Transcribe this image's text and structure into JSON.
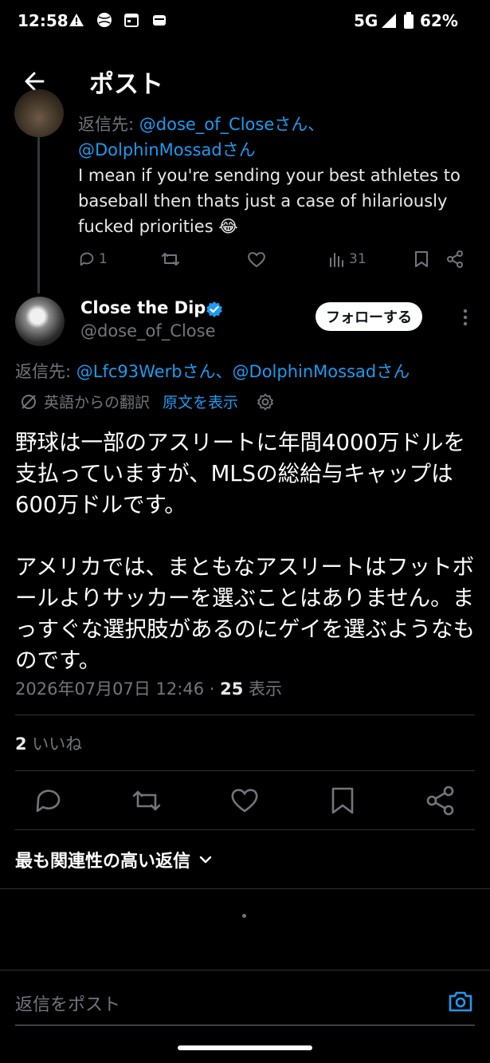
{
  "status_bar": {
    "time": "12:58",
    "network": "5G",
    "battery": "62%"
  },
  "header": {
    "title": "ポスト"
  },
  "prev_post": {
    "reply_to_prefix": "返信先: ",
    "reply_to_line1": "@dose_of_Closeさん、",
    "reply_to_line2": "@DolphinMossadさん",
    "body": "I mean if you're sending your best athletes to baseball then thats just a case of hilariously fucked priorities 😂",
    "reply_count": "1",
    "view_count": "31"
  },
  "post": {
    "display_name": "Close the Dip",
    "handle": "@dose_of_Close",
    "follow_label": "フォローする",
    "reply_to_prefix": "返信先: ",
    "reply_to_targets": "@Lfc93Werbさん、@DolphinMossadさん",
    "translation_label": "英語からの翻訳",
    "show_original_label": "原文を表示",
    "body": "野球は一部のアスリートに年間4000万ドルを支払っていますが、MLSの総給与キャップは600万ドルです。\n\nアメリカでは、まともなアスリートはフットボールよりサッカーを選ぶことはありません。まっすぐな選択肢があるのにゲイを選ぶようなものです。",
    "timestamp": "2026年07月07日 12:46 · ",
    "views_count": "25",
    "views_label": " 表示",
    "likes_count": "2",
    "likes_label": " いいね"
  },
  "replies_sort_label": "最も関連性の高い返信",
  "compose_placeholder": "返信をポスト",
  "colors": {
    "accent": "#1d9bf0",
    "background": "#000000",
    "muted": "#71767b"
  }
}
